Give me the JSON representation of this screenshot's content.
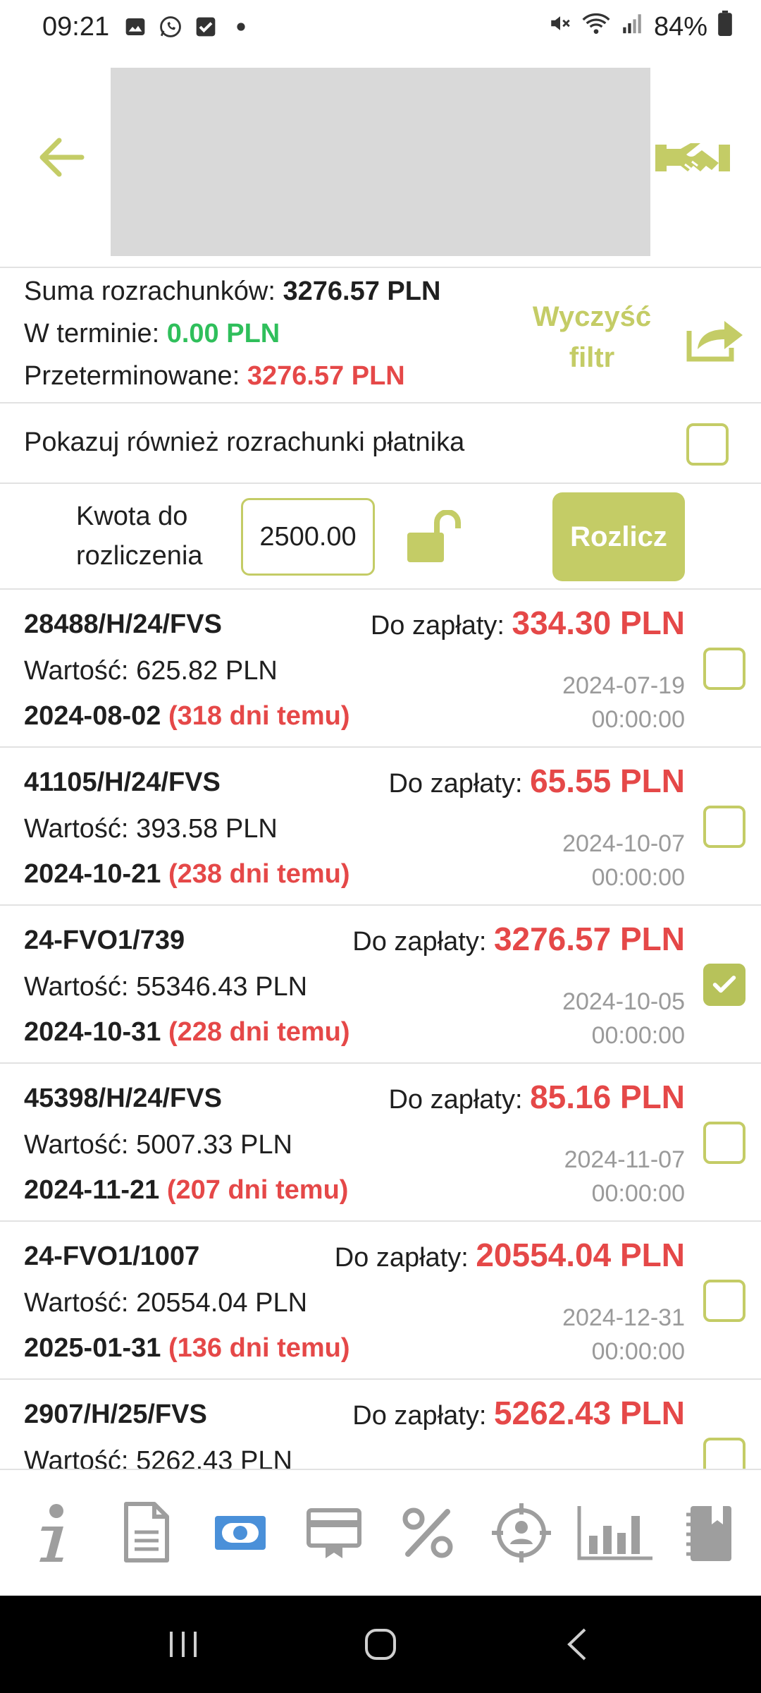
{
  "status_bar": {
    "time": "09:21",
    "battery": "84%",
    "icons": [
      "gallery-icon",
      "whatsapp-icon",
      "check-icon",
      "dot-icon",
      "mute-icon",
      "wifi-icon",
      "signal-icon",
      "battery-icon"
    ]
  },
  "header": {
    "back_icon": "arrow-left-icon",
    "logo": "redacted-logo",
    "action_icon": "handshake-icon"
  },
  "summary": {
    "total_label": "Suma rozrachunków:",
    "total_value": "3276.57 PLN",
    "ontime_label": "W terminie:",
    "ontime_value": "0.00 PLN",
    "overdue_label": "Przeterminowane:",
    "overdue_value": "3276.57 PLN",
    "clear_filter_line1": "Wyczyść",
    "clear_filter_line2": "filtr",
    "share_icon": "share-icon"
  },
  "payer_toggle": {
    "label": "Pokazuj również rozrachunki płatnika",
    "checked": false
  },
  "settlement": {
    "label_line1": "Kwota do",
    "label_line2": "rozliczenia",
    "amount": "2500.00",
    "lock_icon": "unlock-icon",
    "button_label": "Rozlicz"
  },
  "list_labels": {
    "due_prefix": "Do zapłaty:",
    "value_prefix": "Wartość:"
  },
  "invoices": [
    {
      "number": "28488/H/24/FVS",
      "due": "334.30 PLN",
      "value": "625.82 PLN",
      "due_date": "2024-08-02",
      "days": "(318 dni temu)",
      "issue_date": "2024-07-19",
      "issue_time": "00:00:00",
      "checked": false
    },
    {
      "number": "41105/H/24/FVS",
      "due": "65.55 PLN",
      "value": "393.58 PLN",
      "due_date": "2024-10-21",
      "days": "(238 dni temu)",
      "issue_date": "2024-10-07",
      "issue_time": "00:00:00",
      "checked": false
    },
    {
      "number": "24-FVO1/739",
      "due": "3276.57 PLN",
      "value": "55346.43 PLN",
      "due_date": "2024-10-31",
      "days": "(228 dni temu)",
      "issue_date": "2024-10-05",
      "issue_time": "00:00:00",
      "checked": true
    },
    {
      "number": "45398/H/24/FVS",
      "due": "85.16 PLN",
      "value": "5007.33 PLN",
      "due_date": "2024-11-21",
      "days": "(207 dni temu)",
      "issue_date": "2024-11-07",
      "issue_time": "00:00:00",
      "checked": false
    },
    {
      "number": "24-FVO1/1007",
      "due": "20554.04 PLN",
      "value": "20554.04 PLN",
      "due_date": "2025-01-31",
      "days": "(136 dni temu)",
      "issue_date": "2024-12-31",
      "issue_time": "00:00:00",
      "checked": false
    },
    {
      "number": "2907/H/25/FVS",
      "due": "5262.43 PLN",
      "value": "5262.43 PLN",
      "due_date": "",
      "days": "",
      "issue_date": "",
      "issue_time": "",
      "checked": false
    }
  ],
  "bottom_nav": [
    "info-icon",
    "document-icon",
    "money-icon",
    "card-icon",
    "percent-icon",
    "target-person-icon",
    "bar-chart-icon",
    "notebook-icon"
  ],
  "bottom_nav_active": 2,
  "colors": {
    "accent": "#c4cc66",
    "accent_dark": "#b7c25a",
    "overdue": "#e54848",
    "ontime": "#2fbf5b",
    "nav_active": "#4a90d9",
    "nav_inactive": "#9e9e9e"
  }
}
